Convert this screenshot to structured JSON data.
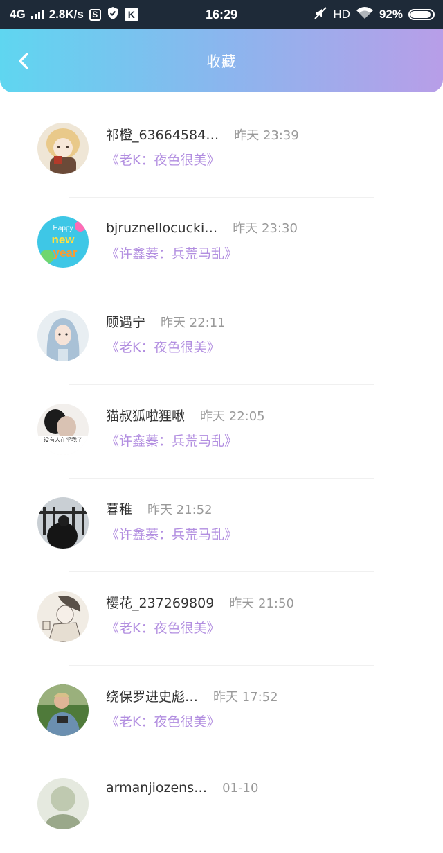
{
  "status_bar": {
    "network": "4G",
    "speed": "2.8K/s",
    "s_badge": "S",
    "k_badge": "K",
    "time": "16:29",
    "hd": "HD",
    "battery": "92%",
    "battery_level": 0.92
  },
  "header": {
    "title": "收藏",
    "back_icon": "chevron-left-icon",
    "gradient_start": "#5fd6f0",
    "gradient_end": "#b89ee8"
  },
  "accent_color": "#b28ee0",
  "items": [
    {
      "name": "祁橙_63664584…",
      "time": "昨天 23:39",
      "quote": "《老K：夜色很美》"
    },
    {
      "name": "bjruznellocucki…",
      "time": "昨天 23:30",
      "quote": "《许鑫蓁：兵荒马乱》"
    },
    {
      "name": "顾遇宁",
      "time": "昨天 22:11",
      "quote": "《老K：夜色很美》"
    },
    {
      "name": "猫叔狐啦狸啾",
      "time": "昨天 22:05",
      "quote": "《许鑫蓁：兵荒马乱》"
    },
    {
      "name": "暮稚",
      "time": "昨天 21:52",
      "quote": "《许鑫蓁：兵荒马乱》"
    },
    {
      "name": "樱花_237269809",
      "time": "昨天 21:50",
      "quote": "《老K：夜色很美》"
    },
    {
      "name": "绕保罗进史彪…",
      "time": "昨天 17:52",
      "quote": "《老K：夜色很美》"
    },
    {
      "name": "armanjiozens…",
      "time": "01-10",
      "quote": ""
    }
  ],
  "avatar_texts": {
    "new_year_top": "Happy",
    "new_year_mid": "new",
    "new_year_bottom": "year",
    "caption": "没有人在乎我了"
  }
}
